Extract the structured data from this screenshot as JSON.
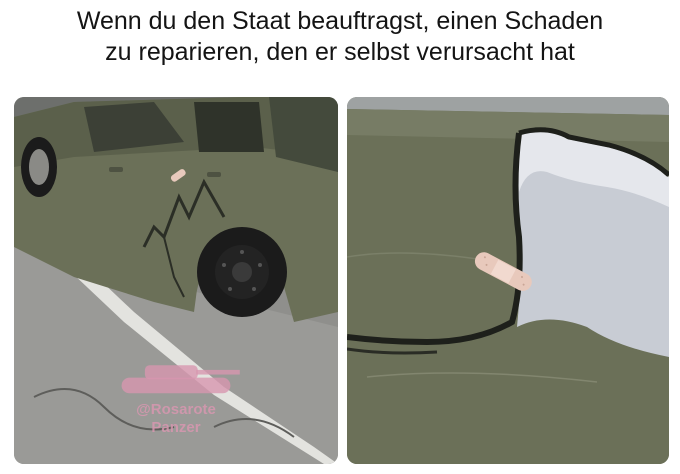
{
  "caption": {
    "line1": "Wenn du den Staat beauftragst, einen Schaden",
    "line2": "zu reparieren, den er selbst verursacht hat"
  },
  "watermark": {
    "handle": "@Rosarote",
    "name": "Panzer",
    "icon": "tank-icon"
  },
  "colors": {
    "car_body": "#6b7058",
    "asphalt": "#8f8f8c",
    "bandage": "#e8c9bc"
  }
}
